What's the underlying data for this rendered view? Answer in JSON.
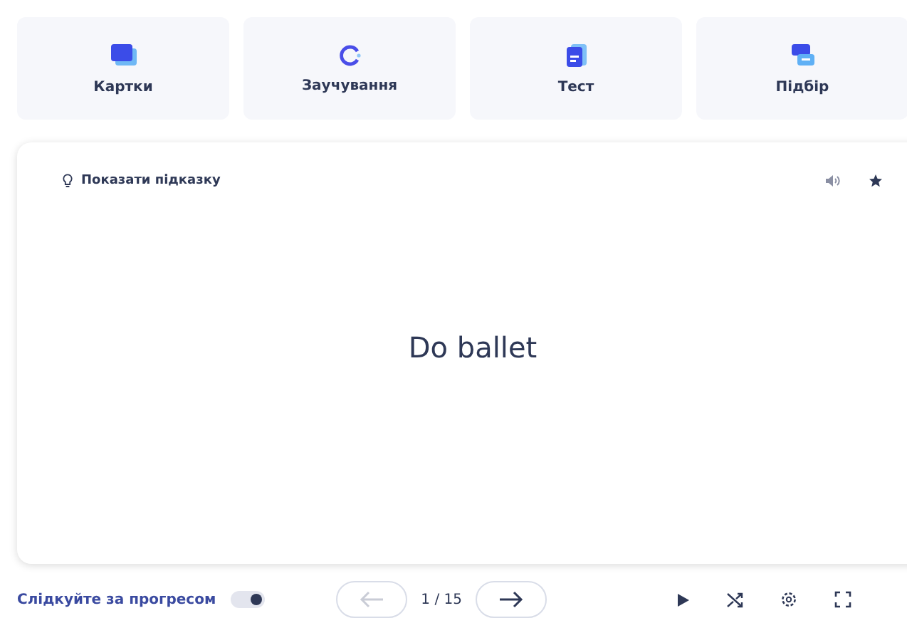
{
  "modes": [
    {
      "label": "Картки",
      "kind": "cards"
    },
    {
      "label": "Заучування",
      "kind": "learn"
    },
    {
      "label": "Тест",
      "kind": "test"
    },
    {
      "label": "Підбір",
      "kind": "match"
    }
  ],
  "card": {
    "hint": "Показати підказку",
    "term": "Do ballet",
    "starred": false
  },
  "footer": {
    "progress_label": "Слідкуйте за прогресом",
    "progress_on": true,
    "prev_disabled": true,
    "next_disabled": false,
    "counter": "1 / 15"
  }
}
